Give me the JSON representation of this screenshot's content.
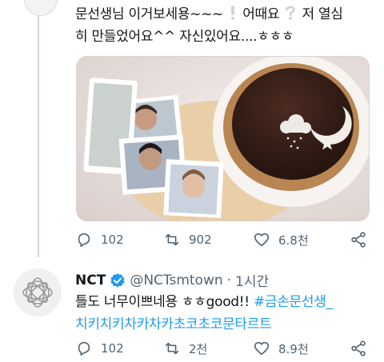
{
  "tweet1": {
    "text_line1": "문선생님 이거보세용~~~",
    "text_line1b": "어때요",
    "text_line1c": "저 열심",
    "text_line2": "히 만들었어요^^  자신있어요....ㅎㅎㅎ",
    "actions": {
      "replies": "102",
      "retweets": "902",
      "likes": "6.8천"
    }
  },
  "tweet2": {
    "display_name": "NCT",
    "handle": "@NCTsmtown",
    "separator": "·",
    "time": "1시간",
    "text_prefix": "틀도 너무이쁘네용 ㅎㅎgood!! ",
    "hashtag_line1": "#금손문선생_",
    "hashtag_line2": "치키치키차카차카초코초코문타르트",
    "actions": {
      "replies": "102",
      "retweets": "2천",
      "likes": "8.9천"
    }
  },
  "icons": [
    "reply-icon",
    "retweet-icon",
    "like-icon",
    "share-icon",
    "verified-badge-icon",
    "exclamation-icon",
    "question-icon"
  ],
  "colors": {
    "link": "#1d9bf0",
    "muted": "#536471",
    "verified": "#1d9bf0"
  }
}
